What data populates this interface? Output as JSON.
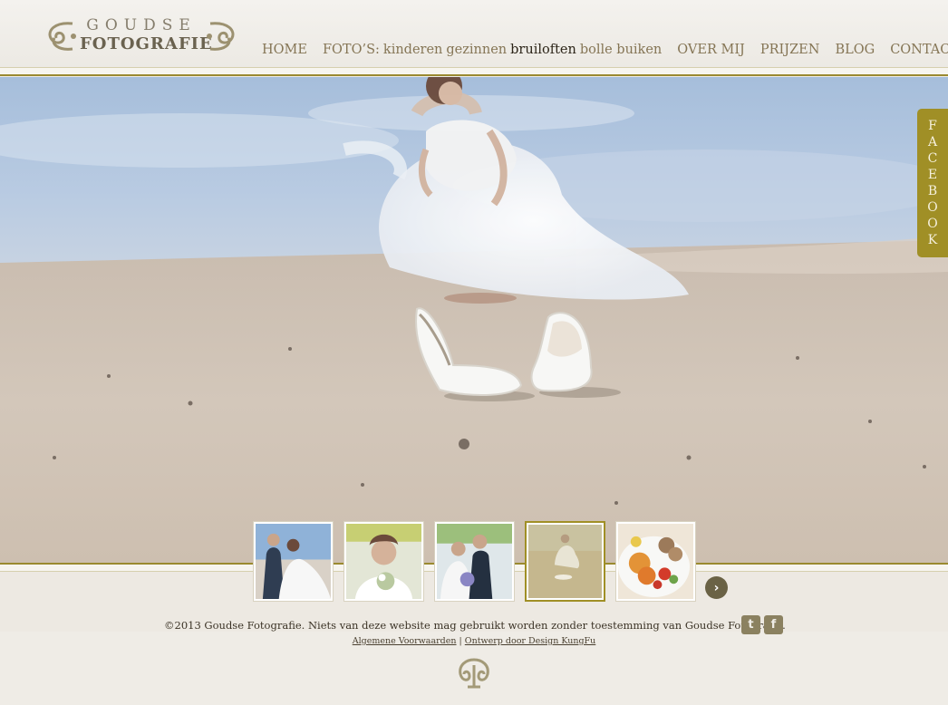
{
  "logo": {
    "top": "GOUDSE",
    "bottom": "FOTOGRAFIE"
  },
  "nav": {
    "home": "HOME",
    "fotos_label": "FOTO’S:",
    "fotos_items": [
      {
        "label": "kinderen",
        "active": false
      },
      {
        "label": "gezinnen",
        "active": false
      },
      {
        "label": "bruiloften",
        "active": true
      },
      {
        "label": "bolle buiken",
        "active": false
      }
    ],
    "over_mij": "OVER MIJ",
    "prijzen": "PRIJZEN",
    "blog": "BLOG",
    "contact": "CONTACT"
  },
  "facebook_tab": {
    "label": "FACEBOOK",
    "color": "#a08f26"
  },
  "thumbnails": [
    {
      "subject": "couple-beach",
      "active": false
    },
    {
      "subject": "bride-bouquet",
      "active": false
    },
    {
      "subject": "couple-standing",
      "active": false
    },
    {
      "subject": "bride-sand",
      "active": true
    },
    {
      "subject": "food-plate",
      "active": false
    }
  ],
  "next_icon": "chevron-right-icon",
  "footer": {
    "copyright": "©2013 Goudse Fotografie. Niets van deze website mag gebruikt worden zonder toestemming van Goudse Fotografie.",
    "link_terms": "Algemene Voorwaarden",
    "separator": "|",
    "link_design": "Ontwerp door Design KungFu",
    "social": [
      {
        "icon": "twitter-icon",
        "glyph": "t"
      },
      {
        "icon": "facebook-icon",
        "glyph": "f"
      }
    ]
  },
  "colors": {
    "accent": "#a08f26",
    "nav_text": "#857555",
    "nav_active": "#2c2418",
    "background": "#efece6"
  }
}
